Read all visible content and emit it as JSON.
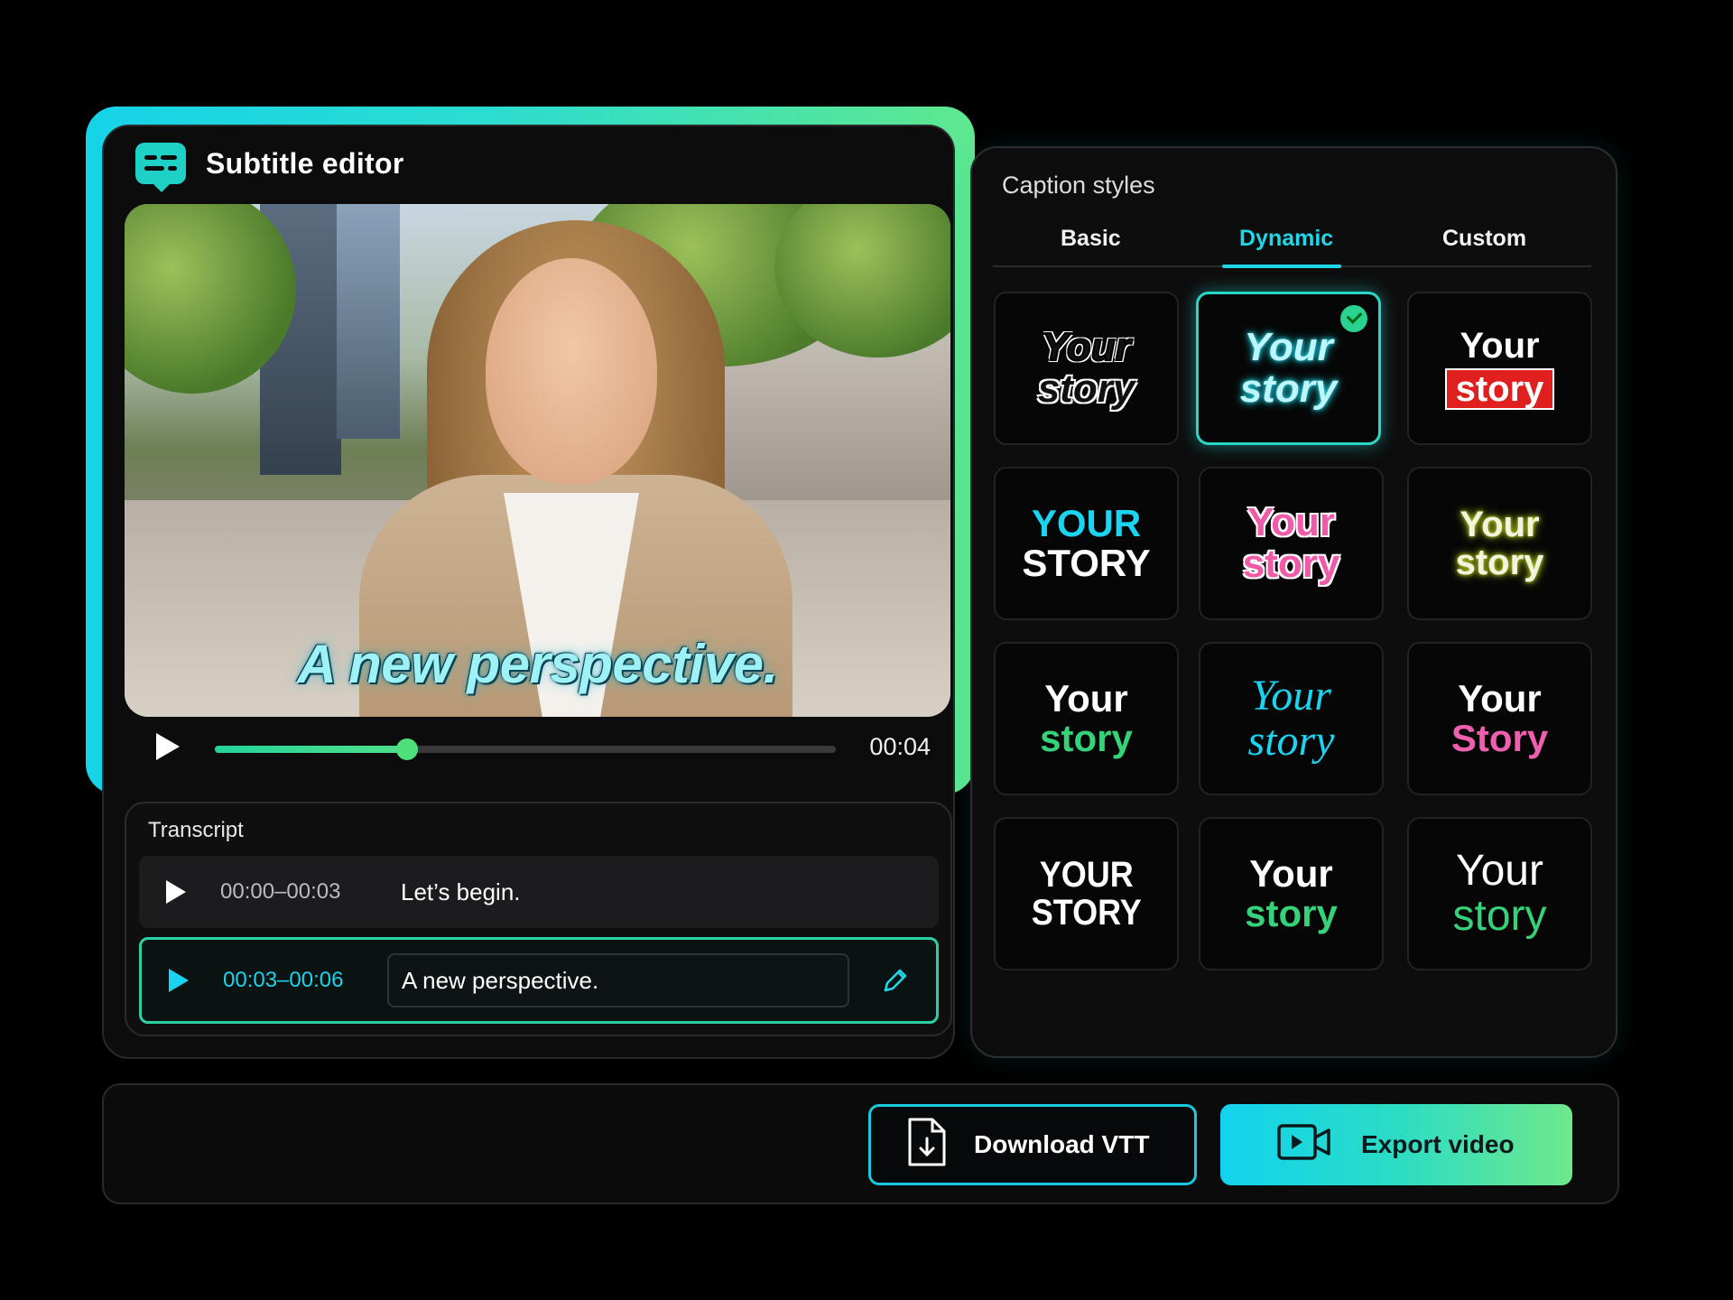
{
  "editor": {
    "title": "Subtitle editor",
    "video_caption": "A new perspective.",
    "player": {
      "time": "00:04",
      "progress": 0.31
    }
  },
  "transcript": {
    "title": "Transcript",
    "rows": [
      {
        "time": "00:00–00:03",
        "text": "Let’s begin."
      },
      {
        "time": "00:03–00:06",
        "text": "A new perspective."
      }
    ]
  },
  "caption_styles": {
    "title": "Caption styles",
    "tabs": [
      "Basic",
      "Dynamic",
      "Custom"
    ],
    "active_tab": "Dynamic",
    "tiles": [
      {
        "line1": "Your",
        "line2": "story"
      },
      {
        "line1": "Your",
        "line2": "story",
        "selected": true
      },
      {
        "line1": "Your",
        "line2": "story"
      },
      {
        "line1": "YOUR",
        "line2": "STORY"
      },
      {
        "line1": "Your",
        "line2": "story"
      },
      {
        "line1": "Your",
        "line2": "story"
      },
      {
        "line1": "Your",
        "line2": "story"
      },
      {
        "line1": "Your",
        "line2": "story"
      },
      {
        "line1": "Your",
        "line2": "Story"
      },
      {
        "line1": "YOUR",
        "line2": "STORY"
      },
      {
        "line1": "Your",
        "line2": "story"
      },
      {
        "line1": "Your",
        "line2": "story"
      }
    ]
  },
  "actions": {
    "download_label": "Download VTT",
    "export_label": "Export video"
  },
  "colors": {
    "accent_cyan": "#1fd7e6",
    "accent_green": "#4fe08a",
    "panel_bg": "#0d0d0e"
  }
}
